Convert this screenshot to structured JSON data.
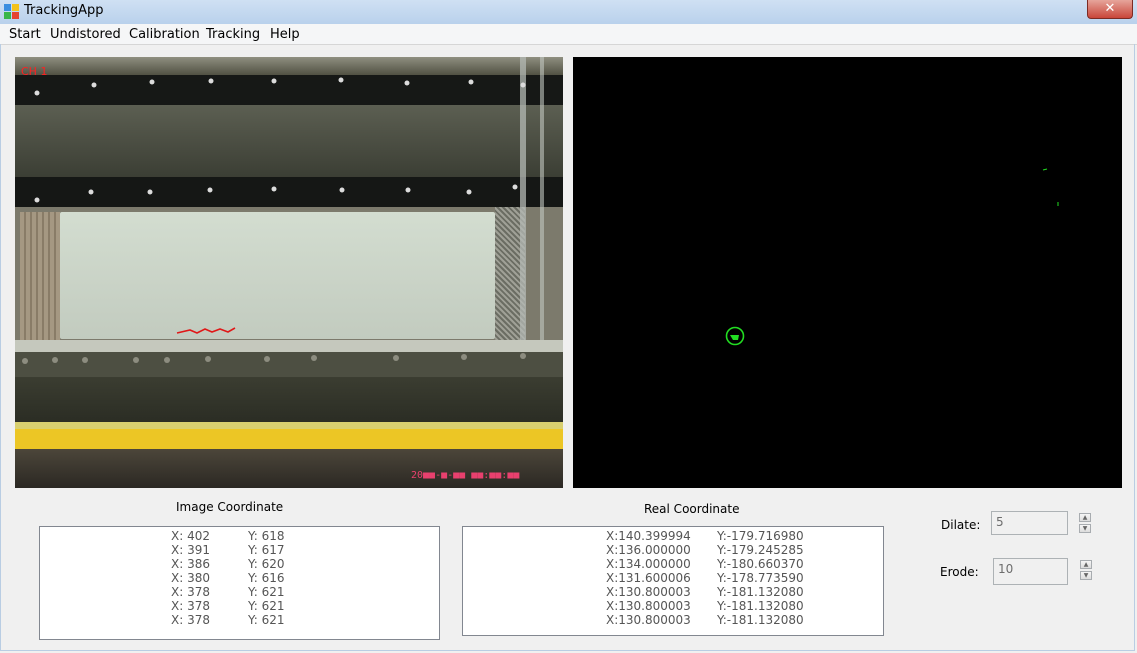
{
  "window": {
    "title": "TrackingApp",
    "close_glyph": "✕"
  },
  "menu": [
    "Start",
    "Undistored",
    "Calibration",
    "Tracking",
    "Help"
  ],
  "camera": {
    "channel_label": "CH 1",
    "timestamp": "20■■-■-■■ ■■:■■:■■"
  },
  "binary_view": {
    "marker_icon": "target-circle-icon"
  },
  "image_coordinate": {
    "title": "Image Coordinate",
    "rows": [
      {
        "x": "X: 402",
        "y": "Y: 618"
      },
      {
        "x": "X: 391",
        "y": "Y: 617"
      },
      {
        "x": "X: 386",
        "y": "Y: 620"
      },
      {
        "x": "X: 380",
        "y": "Y: 616"
      },
      {
        "x": "X: 378",
        "y": "Y: 621"
      },
      {
        "x": "X: 378",
        "y": "Y: 621"
      },
      {
        "x": "X: 378",
        "y": "Y: 621"
      }
    ]
  },
  "real_coordinate": {
    "title": "Real Coordinate",
    "rows": [
      {
        "x": "X:140.399994",
        "y": "Y:-179.716980"
      },
      {
        "x": "X:136.000000",
        "y": "Y:-179.245285"
      },
      {
        "x": "X:134.000000",
        "y": "Y:-180.660370"
      },
      {
        "x": "X:131.600006",
        "y": "Y:-178.773590"
      },
      {
        "x": "X:130.800003",
        "y": "Y:-181.132080"
      },
      {
        "x": "X:130.800003",
        "y": "Y:-181.132080"
      },
      {
        "x": "X:130.800003",
        "y": "Y:-181.132080"
      }
    ]
  },
  "dilate": {
    "label": "Dilate:",
    "value": "5"
  },
  "erode": {
    "label": "Erode:",
    "value": "10"
  },
  "colors": {
    "accent_green": "#22dd22",
    "trail_red": "#e01818",
    "title_bar": "#c4d8f0"
  }
}
